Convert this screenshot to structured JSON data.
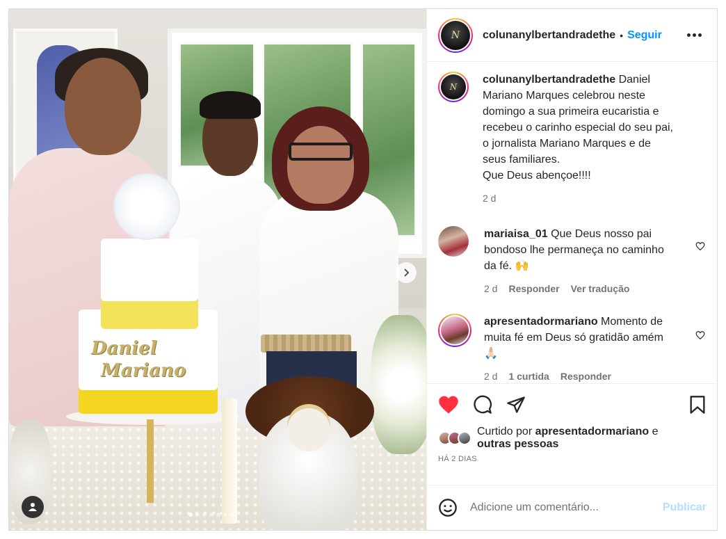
{
  "photo": {
    "cake_text_line1": "Daniel",
    "cake_text_line2": "Mariano",
    "carousel_count": 7,
    "carousel_active": 0
  },
  "header": {
    "username": "colunanylbertandradethe",
    "separator": "•",
    "follow_label": "Seguir",
    "avatar_text": "N"
  },
  "caption": {
    "username": "colunanylbertandradethe",
    "text_lines": [
      " Daniel",
      "Mariano Marques celebrou neste",
      "domingo a sua primeira eucaristia e",
      "recebeu o carinho especial do seu pai,",
      "o jornalista Mariano Marques e de",
      "seus familiares.",
      "Que Deus abençoe!!!!"
    ],
    "time": "2 d"
  },
  "comments": [
    {
      "username": "mariaisa_01",
      "lines": [
        " Que Deus nosso pai",
        "bondoso lhe permaneça no caminho",
        "da fé. 🙌"
      ],
      "time": "2 d",
      "reply_label": "Responder",
      "translate_label": "Ver tradução"
    },
    {
      "username": "apresentadormariano",
      "lines": [
        " Momento de",
        "muita fé em Deus só gratidão amém",
        "🙏🏻"
      ],
      "time": "2 d",
      "likes_label": "1 curtida",
      "reply_label": "Responder"
    }
  ],
  "likes": {
    "prefix": "Curtido por ",
    "user": "apresentadormariano",
    "suffix": " e",
    "others": "outras pessoas",
    "date": "HÁ 2 DIAS"
  },
  "add_comment": {
    "placeholder": "Adicione um comentário...",
    "publish_label": "Publicar"
  },
  "colors": {
    "accent": "#0095f6",
    "like_red": "#ff3040",
    "publish_disabled": "#b2dffc",
    "muted": "#737373"
  },
  "icons": [
    "user-tag-icon",
    "chevron-right-icon",
    "more-icon",
    "heart-icon",
    "comment-icon",
    "share-icon",
    "save-icon",
    "emoji-icon"
  ]
}
